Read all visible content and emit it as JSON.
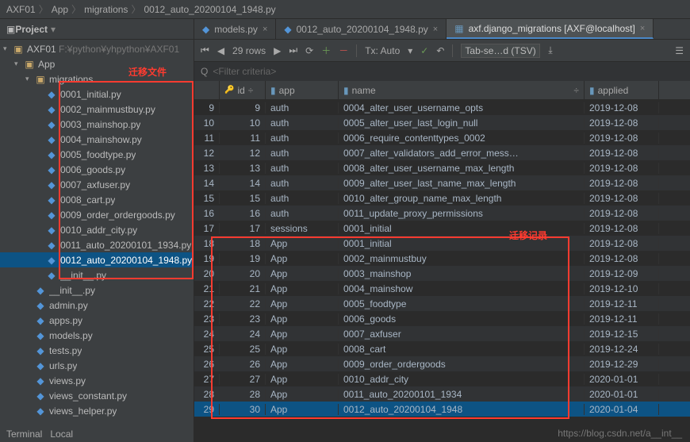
{
  "breadcrumb": [
    "AXF01",
    "App",
    "migrations",
    "0012_auto_20200104_1948.py"
  ],
  "panel": {
    "title": "Project"
  },
  "annotations": {
    "mig_files": "迁移文件",
    "mig_records": "迁移记录"
  },
  "tree": {
    "root": {
      "label": "AXF01",
      "path": "F:¥python¥yhpython¥AXF01"
    },
    "app": "App",
    "migrations": "migrations",
    "files": [
      "0001_initial.py",
      "0002_mainmustbuy.py",
      "0003_mainshop.py",
      "0004_mainshow.py",
      "0005_foodtype.py",
      "0006_goods.py",
      "0007_axfuser.py",
      "0008_cart.py",
      "0009_order_ordergoods.py",
      "0010_addr_city.py",
      "0011_auto_20200101_1934.py",
      "0012_auto_20200104_1948.py"
    ],
    "extra": [
      "__init__.py",
      "__init__.py",
      "admin.py",
      "apps.py",
      "models.py",
      "tests.py",
      "urls.py",
      "views.py",
      "views_constant.py",
      "views_helper.py"
    ]
  },
  "tabs": [
    {
      "label": "models.py",
      "type": "py"
    },
    {
      "label": "0012_auto_20200104_1948.py",
      "type": "py"
    },
    {
      "label": "axf.django_migrations [AXF@localhost]",
      "type": "db",
      "active": true
    }
  ],
  "toolbar": {
    "rows_label": "29 rows",
    "tx_label": "Tx: Auto",
    "search_placeholder": "Tab-se…d (TSV)"
  },
  "filter": {
    "placeholder": "<Filter criteria>"
  },
  "columns": [
    "id",
    "app",
    "name",
    "applied"
  ],
  "rows": [
    {
      "n": 9,
      "id": 9,
      "app": "auth",
      "name": "0004_alter_user_username_opts",
      "applied": "2019-12-08"
    },
    {
      "n": 10,
      "id": 10,
      "app": "auth",
      "name": "0005_alter_user_last_login_null",
      "applied": "2019-12-08"
    },
    {
      "n": 11,
      "id": 11,
      "app": "auth",
      "name": "0006_require_contenttypes_0002",
      "applied": "2019-12-08"
    },
    {
      "n": 12,
      "id": 12,
      "app": "auth",
      "name": "0007_alter_validators_add_error_mess…",
      "applied": "2019-12-08"
    },
    {
      "n": 13,
      "id": 13,
      "app": "auth",
      "name": "0008_alter_user_username_max_length",
      "applied": "2019-12-08"
    },
    {
      "n": 14,
      "id": 14,
      "app": "auth",
      "name": "0009_alter_user_last_name_max_length",
      "applied": "2019-12-08"
    },
    {
      "n": 15,
      "id": 15,
      "app": "auth",
      "name": "0010_alter_group_name_max_length",
      "applied": "2019-12-08"
    },
    {
      "n": 16,
      "id": 16,
      "app": "auth",
      "name": "0011_update_proxy_permissions",
      "applied": "2019-12-08"
    },
    {
      "n": 17,
      "id": 17,
      "app": "sessions",
      "name": "0001_initial",
      "applied": "2019-12-08"
    },
    {
      "n": 18,
      "id": 18,
      "app": "App",
      "name": "0001_initial",
      "applied": "2019-12-08"
    },
    {
      "n": 19,
      "id": 19,
      "app": "App",
      "name": "0002_mainmustbuy",
      "applied": "2019-12-08"
    },
    {
      "n": 20,
      "id": 20,
      "app": "App",
      "name": "0003_mainshop",
      "applied": "2019-12-09"
    },
    {
      "n": 21,
      "id": 21,
      "app": "App",
      "name": "0004_mainshow",
      "applied": "2019-12-10"
    },
    {
      "n": 22,
      "id": 22,
      "app": "App",
      "name": "0005_foodtype",
      "applied": "2019-12-11"
    },
    {
      "n": 23,
      "id": 23,
      "app": "App",
      "name": "0006_goods",
      "applied": "2019-12-11"
    },
    {
      "n": 24,
      "id": 24,
      "app": "App",
      "name": "0007_axfuser",
      "applied": "2019-12-15"
    },
    {
      "n": 25,
      "id": 25,
      "app": "App",
      "name": "0008_cart",
      "applied": "2019-12-24"
    },
    {
      "n": 26,
      "id": 26,
      "app": "App",
      "name": "0009_order_ordergoods",
      "applied": "2019-12-29"
    },
    {
      "n": 27,
      "id": 27,
      "app": "App",
      "name": "0010_addr_city",
      "applied": "2020-01-01"
    },
    {
      "n": 28,
      "id": 28,
      "app": "App",
      "name": "0011_auto_20200101_1934",
      "applied": "2020-01-01"
    },
    {
      "n": 29,
      "id": 30,
      "app": "App",
      "name": "0012_auto_20200104_1948",
      "applied": "2020-01-04",
      "selected": true
    }
  ],
  "bottom": [
    "Terminal",
    "Local"
  ],
  "watermark": "https://blog.csdn.net/a__int__"
}
